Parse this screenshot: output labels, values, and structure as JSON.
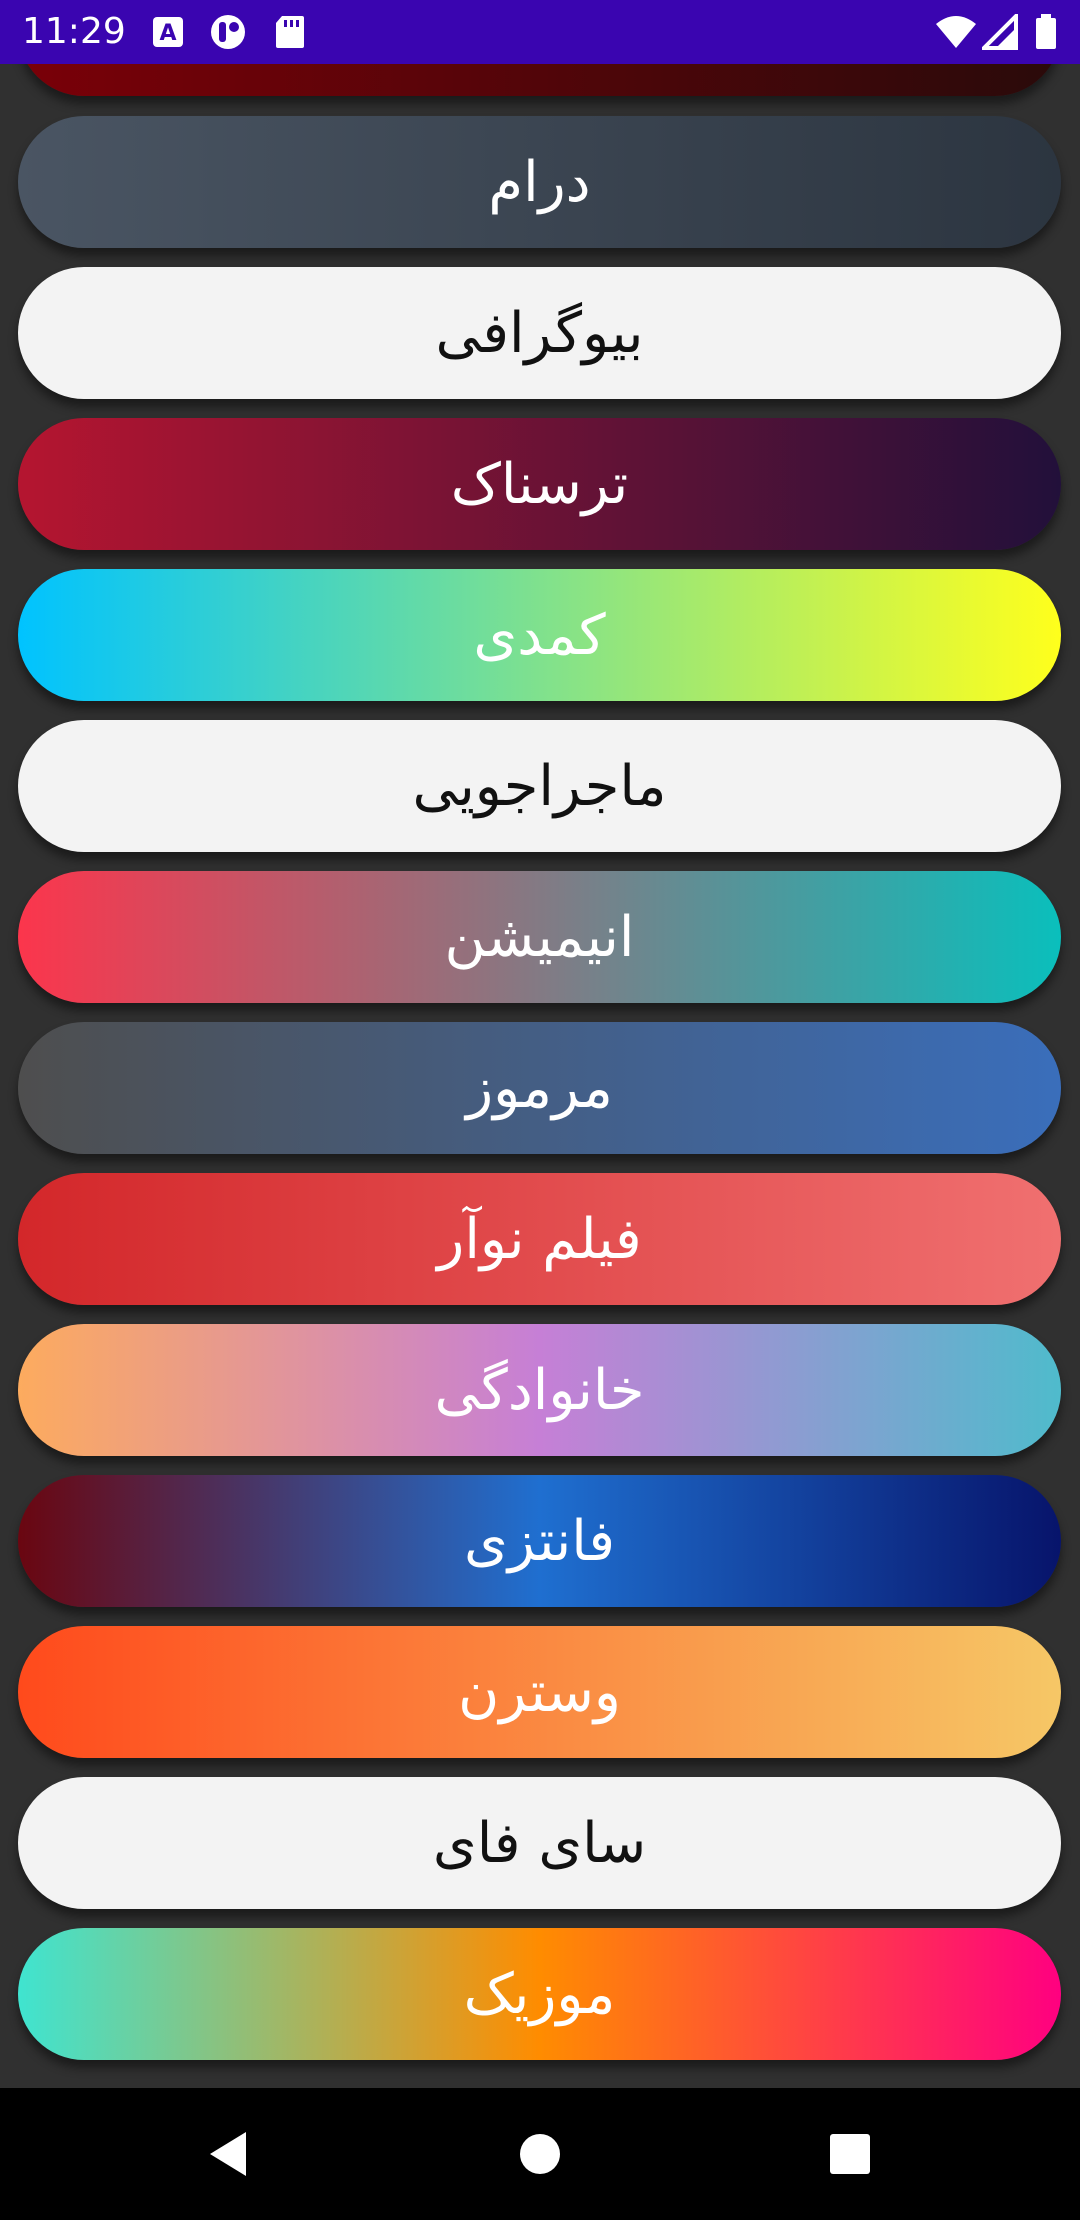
{
  "status_bar": {
    "time": "11:29",
    "left_icons": [
      "keyboard-a-icon",
      "t-app-icon",
      "sd-card-icon"
    ],
    "right_icons": [
      "wifi-icon",
      "cell-signal-icon",
      "battery-icon"
    ],
    "background": "#3a05b0"
  },
  "genres": [
    {
      "label": "درام",
      "text_color": "#ffffff",
      "gradient": [
        "#4a5563",
        "#2c3540"
      ]
    },
    {
      "label": "بیوگرافی",
      "text_color": "#111111",
      "gradient": [
        "#f3f3f3",
        "#f3f3f3"
      ]
    },
    {
      "label": "ترسناک",
      "text_color": "#ffffff",
      "gradient": [
        "#b51530",
        "#22103a"
      ]
    },
    {
      "label": "کمدی",
      "text_color": "#ffffff",
      "gradient": [
        "#00c3ff",
        "#ffff1c"
      ]
    },
    {
      "label": "ماجراجویی",
      "text_color": "#111111",
      "gradient": [
        "#f3f3f3",
        "#f3f3f3"
      ]
    },
    {
      "label": "انیمیشن",
      "text_color": "#ffffff",
      "gradient": [
        "#fc354c",
        "#0abfbc"
      ]
    },
    {
      "label": "مرموز",
      "text_color": "#ffffff",
      "gradient": [
        "#4e4e4e",
        "#3a6ebb"
      ]
    },
    {
      "label": "فیلم نوآر",
      "text_color": "#ffffff",
      "gradient": [
        "#d3272a",
        "#f07070"
      ]
    },
    {
      "label": "خانوادگی",
      "text_color": "#ffffff",
      "gradient": [
        "#fdab5e",
        "#c67fd6",
        "#4fbbcc"
      ]
    },
    {
      "label": "فانتزی",
      "text_color": "#ffffff",
      "gradient": [
        "#6a0610",
        "#1f6fd0",
        "#07146b"
      ]
    },
    {
      "label": "وسترن",
      "text_color": "#ffffff",
      "gradient": [
        "#ff4a1c",
        "#f6c766"
      ]
    },
    {
      "label": "سای فای",
      "text_color": "#111111",
      "gradient": [
        "#f3f3f3",
        "#f3f3f3"
      ]
    },
    {
      "label": "موزیک",
      "text_color": "#ffffff",
      "gradient": [
        "#3fe4d0",
        "#ff8c00",
        "#ff0080"
      ]
    }
  ],
  "partial_top_gradient": [
    "#7a0008",
    "#2a0a0a"
  ],
  "nav_bar": {
    "buttons": [
      "back-icon",
      "home-icon",
      "recents-icon"
    ]
  }
}
